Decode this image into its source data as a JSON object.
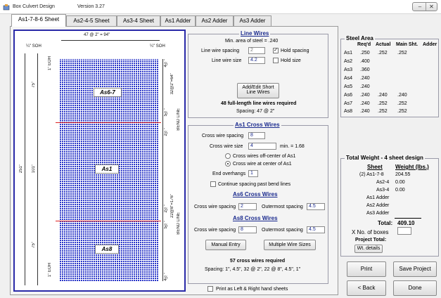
{
  "window": {
    "title": "Box Culvert Design",
    "version": "Version 3.27",
    "min_label": "–",
    "close_label": "✕"
  },
  "tabs": [
    {
      "label": "As1-7-8-6 Sheet",
      "active": true
    },
    {
      "label": "As2-4-5 Sheet",
      "active": false
    },
    {
      "label": "As3-4 Sheet",
      "active": false
    },
    {
      "label": "As1 Adder",
      "active": false
    },
    {
      "label": "As2 Adder",
      "active": false
    },
    {
      "label": "As3 Adder",
      "active": false
    }
  ],
  "drawing": {
    "top_dim": "47 @ 2\" = 94\"",
    "soh_left": "¼\" SOH",
    "soh_right": "¼\" SOH",
    "eoh_top": "1\" EOH",
    "eoh_bottom": "1\" EOH",
    "left_dim_top": "75\"",
    "left_dim_mid": "101\"",
    "left_dim_bot": "75\"",
    "overall_height": "251\"",
    "panels": [
      "As6-7",
      "As1",
      "As8"
    ],
    "right_top": "32@2\"=64\"",
    "right_mid": "22@8\"=176\"",
    "right_s1": "4½\"",
    "right_s2": "5½\"",
    "right_s3": "2½\"",
    "right_s4": "2½\"",
    "right_s5": "5½\"",
    "right_s6": "4½\"",
    "bend_line": "BEND LINE"
  },
  "line_wires": {
    "title": "Line Wires",
    "min_area": "Min. area of steel = .240",
    "spacing_label": "Line wire spacing",
    "spacing_value": "2",
    "hold_spacing_label": "Hold spacing",
    "hold_spacing_checked": "✓",
    "size_label": "Line wire size",
    "size_value": "4.2",
    "hold_size_label": "Hold size",
    "add_edit_line1": "Add/Edit Short",
    "add_edit_line2": "Line Wires",
    "required": "48 full-length line wires required",
    "spacing_text": "Spacing:  47 @ 2\""
  },
  "as1_cross": {
    "title": "As1 Cross Wires",
    "spacing_label": "Cross wire spacing",
    "spacing_value": "8",
    "size_label": "Cross wire size",
    "size_value": "4",
    "min_text": "min. = 1.68",
    "radio1": "Cross wires off-center of As1",
    "radio2": "Cross wire at center of As1",
    "overhangs_label": "End overhangs",
    "overhangs_value": "1",
    "continue_label": "Continue spacing past bend lines"
  },
  "as6_cross": {
    "title": "As6 Cross Wires",
    "spacing_label": "Cross wire spacing",
    "spacing_value": "2",
    "outer_label": "Outermost spacing",
    "outer_value": "4.5"
  },
  "as8_cross": {
    "title": "As8 Cross Wires",
    "spacing_label": "Cross wire spacing",
    "spacing_value": "8",
    "outer_label": "Outermost spacing",
    "outer_value": "4.5"
  },
  "buttons": {
    "manual_entry": "Manual Entry",
    "multiple_sizes": "Multiple Wire Sizes"
  },
  "cross_summary": {
    "required": "57 cross wires required",
    "spacing": "Spacing:  1\", 4.5\", 32 @ 2\", 22 @ 8\", 4.5\", 1\""
  },
  "print_lr": "Print as Left & Right hand sheets",
  "steel_area": {
    "title": "Steel Area",
    "headers": [
      "Req'd",
      "Actual",
      "Main Sht.",
      "Adder"
    ],
    "rows": [
      {
        "name": "As1",
        "req": ".250",
        "actual": ".252",
        "main": ".252",
        "adder": ""
      },
      {
        "name": "As2",
        "req": ".400",
        "actual": "",
        "main": "",
        "adder": ""
      },
      {
        "name": "As3",
        "req": ".360",
        "actual": "",
        "main": "",
        "adder": ""
      },
      {
        "name": "As4",
        "req": ".240",
        "actual": "",
        "main": "",
        "adder": ""
      },
      {
        "name": "As5",
        "req": ".240",
        "actual": "",
        "main": "",
        "adder": ""
      },
      {
        "name": "As6",
        "req": ".240",
        "actual": ".240",
        "main": ".240",
        "adder": ""
      },
      {
        "name": "As7",
        "req": ".240",
        "actual": ".252",
        "main": ".252",
        "adder": ""
      },
      {
        "name": "As8",
        "req": ".240",
        "actual": ".252",
        "main": ".252",
        "adder": ""
      }
    ]
  },
  "total_weight": {
    "title": "Total Weight - 4 sheet design",
    "sheet_hdr": "Sheet",
    "weight_hdr": "Weight (lbs.)",
    "rows": [
      {
        "sheet": "(2) As1-7-8",
        "weight": "204.55"
      },
      {
        "sheet": "As2-4",
        "weight": "0.00"
      },
      {
        "sheet": "As3-4",
        "weight": "0.00"
      },
      {
        "sheet": "As1 Adder",
        "weight": ""
      },
      {
        "sheet": "As2 Adder",
        "weight": ""
      },
      {
        "sheet": "As3 Adder",
        "weight": ""
      }
    ],
    "total_label": "Total:",
    "total_value": "409.10",
    "boxes_label": "X  No. of boxes",
    "boxes_value": "",
    "project_total": "Project Total:",
    "wt_details": "Wt. details"
  },
  "actions": {
    "print": "Print",
    "save_project": "Save Project",
    "back": "< Back",
    "done": "Done"
  }
}
